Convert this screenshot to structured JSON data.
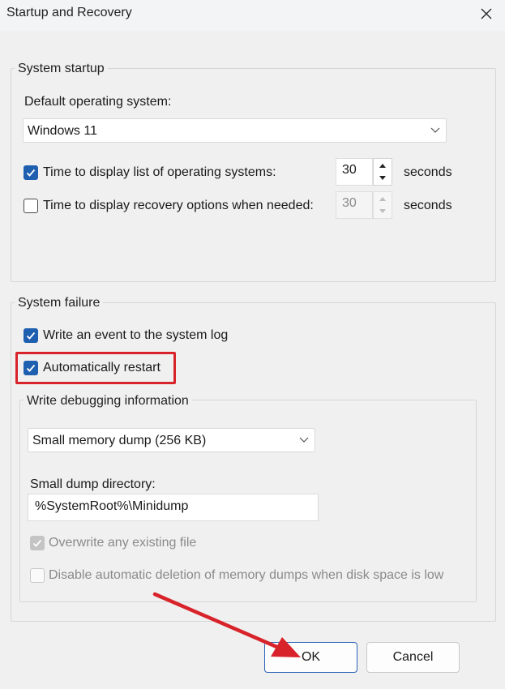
{
  "window": {
    "title": "Startup and Recovery"
  },
  "system_startup": {
    "group_title": "System startup",
    "default_os_label": "Default operating system:",
    "default_os_value": "Windows 11",
    "display_list": {
      "label": "Time to display list of operating systems:",
      "checked": true,
      "value": "30",
      "unit": "seconds"
    },
    "display_recovery": {
      "label": "Time to display recovery options when needed:",
      "checked": false,
      "value": "30",
      "unit": "seconds"
    }
  },
  "system_failure": {
    "group_title": "System failure",
    "write_event": {
      "label": "Write an event to the system log",
      "checked": true
    },
    "auto_restart": {
      "label": "Automatically restart",
      "checked": true,
      "highlighted": true
    },
    "debug": {
      "group_title": "Write debugging information",
      "dump_type": "Small memory dump (256 KB)",
      "dir_label": "Small dump directory:",
      "dir_value": "%SystemRoot%\\Minidump",
      "overwrite": {
        "label": "Overwrite any existing file",
        "checked": true,
        "enabled": false
      },
      "disable_auto_delete": {
        "label": "Disable automatic deletion of memory dumps when disk space is low",
        "checked": false,
        "enabled": false
      }
    }
  },
  "buttons": {
    "ok": "OK",
    "cancel": "Cancel"
  },
  "annotation": {
    "color": "#d8232a",
    "icon": "red-arrow-icon"
  },
  "colors": {
    "accent": "#1e5fb0",
    "highlight": "#d8232a"
  }
}
